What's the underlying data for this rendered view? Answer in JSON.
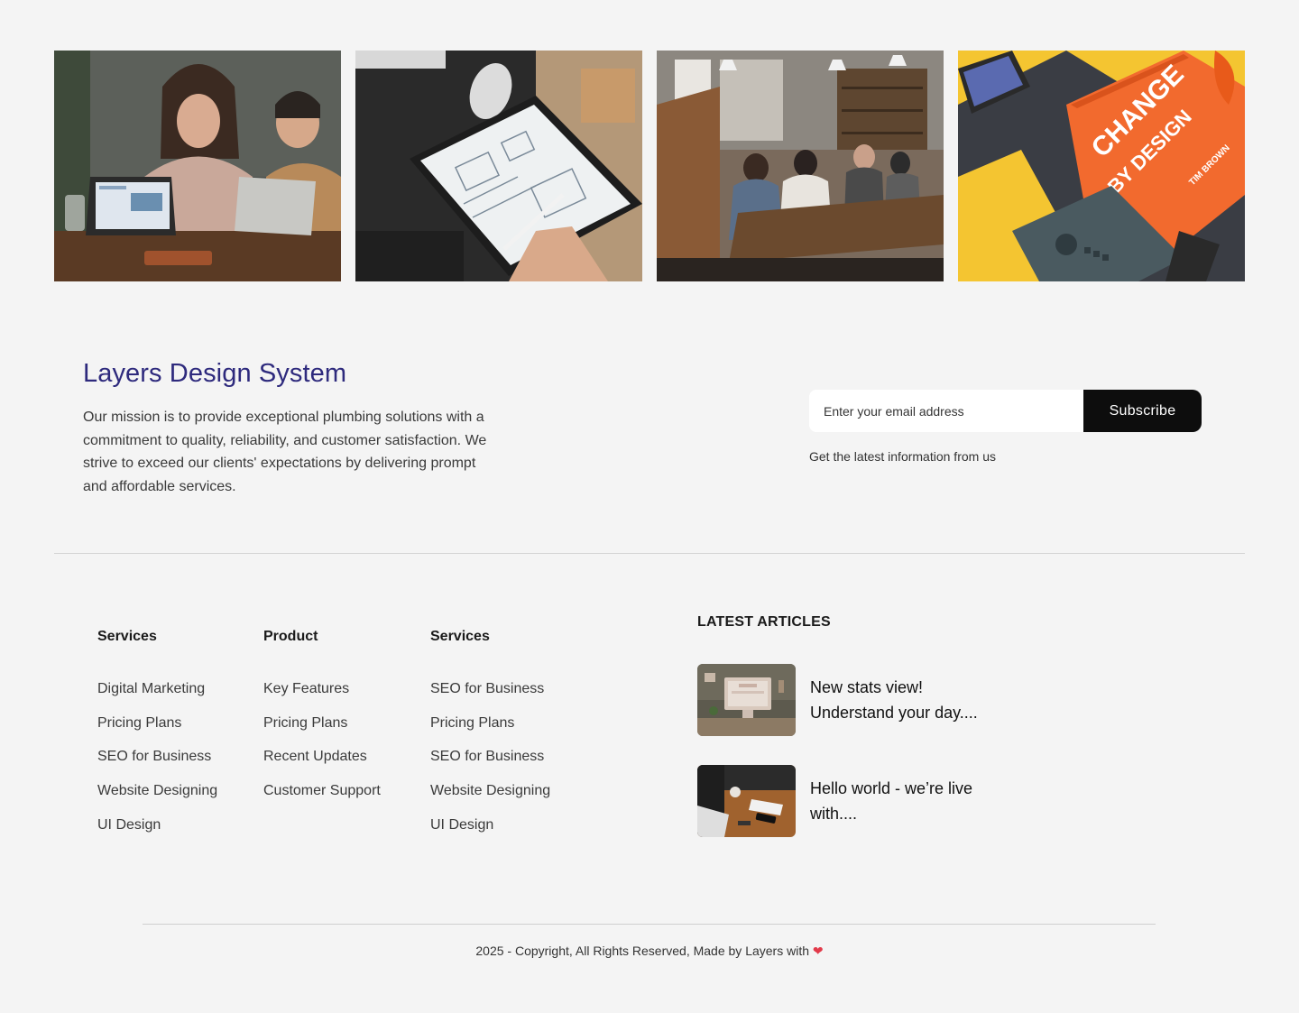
{
  "gallery": {
    "images": [
      {
        "alt": "people-laptop-meeting-photo"
      },
      {
        "alt": "tablet-wireframe-sketch-photo"
      },
      {
        "alt": "team-office-meeting-photo"
      },
      {
        "alt": "change-by-design-book-photo"
      }
    ]
  },
  "brand": {
    "title": "Layers Design System",
    "mission": "Our mission is to provide exceptional plumbing solutions with a commitment to quality, reliability, and customer satisfaction. We strive to exceed our clients' expectations by delivering prompt and affordable services.",
    "accent_color": "#2e2a7d"
  },
  "newsletter": {
    "email_placeholder": "Enter your email address",
    "email_value": "",
    "subscribe_label": "Subscribe",
    "note": "Get the latest information from us"
  },
  "columns": [
    {
      "title": "Services",
      "links": [
        "Digital Marketing",
        "Pricing Plans",
        "SEO for Business",
        "Website Designing",
        "UI Design"
      ]
    },
    {
      "title": "Product",
      "links": [
        "Key Features",
        "Pricing Plans",
        "Recent Updates",
        "Customer Support"
      ]
    },
    {
      "title": "Services",
      "links": [
        "SEO for Business",
        "Pricing Plans",
        "SEO for Business",
        "Website Designing",
        "UI Design"
      ]
    }
  ],
  "articles": {
    "title": "LATEST ARTICLES",
    "items": [
      {
        "title": "New stats view! Understand your day....",
        "thumb": "desk-monitor-thumbnail"
      },
      {
        "title": "Hello world - we’re live with....",
        "thumb": "laptop-desk-thumbnail"
      }
    ]
  },
  "footer": {
    "copyright": "2025 - Copyright, All Rights Reserved, Made by Layers with",
    "heart_icon": "heart-icon",
    "heart_color": "#e23a4a"
  }
}
